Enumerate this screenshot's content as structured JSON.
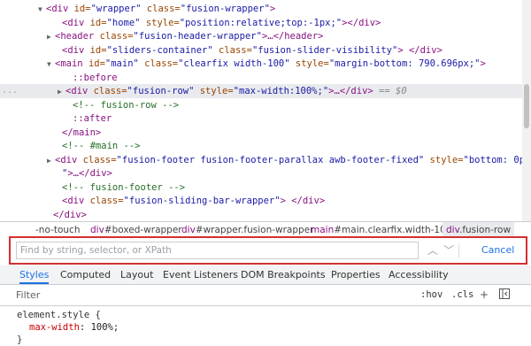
{
  "dom_lines": [
    {
      "tri": "▼",
      "parts": [
        {
          "c": "tag",
          "t": "<div "
        },
        {
          "c": "attr",
          "t": "id="
        },
        {
          "c": "val",
          "t": "\"wrapper\""
        },
        {
          "c": "attr",
          "t": " class="
        },
        {
          "c": "val",
          "t": "\"fusion-wrapper\""
        },
        {
          "c": "tag",
          "t": ">"
        }
      ]
    },
    {
      "tri": "",
      "parts": [
        {
          "c": "tag",
          "t": "<div "
        },
        {
          "c": "attr",
          "t": "id="
        },
        {
          "c": "val",
          "t": "\"home\""
        },
        {
          "c": "attr",
          "t": " style="
        },
        {
          "c": "val",
          "t": "\"position:relative;top:-1px;\""
        },
        {
          "c": "tag",
          "t": "></div>"
        }
      ]
    },
    {
      "tri": "▶",
      "parts": [
        {
          "c": "tag",
          "t": "<header "
        },
        {
          "c": "attr",
          "t": "class="
        },
        {
          "c": "val",
          "t": "\"fusion-header-wrapper\""
        },
        {
          "c": "tag",
          "t": ">…</header>"
        }
      ]
    },
    {
      "tri": "",
      "parts": [
        {
          "c": "tag",
          "t": "<div "
        },
        {
          "c": "attr",
          "t": "id="
        },
        {
          "c": "val",
          "t": "\"sliders-container\""
        },
        {
          "c": "attr",
          "t": " class="
        },
        {
          "c": "val",
          "t": "\"fusion-slider-visibility\""
        },
        {
          "c": "tag",
          "t": "> </div>"
        }
      ]
    },
    {
      "tri": "▼",
      "parts": [
        {
          "c": "tag",
          "t": "<main "
        },
        {
          "c": "attr",
          "t": "id="
        },
        {
          "c": "val",
          "t": "\"main\""
        },
        {
          "c": "attr",
          "t": " class="
        },
        {
          "c": "val",
          "t": "\"clearfix width-100\""
        },
        {
          "c": "attr",
          "t": " style="
        },
        {
          "c": "val",
          "t": "\"margin-bottom: 790.696px;\""
        },
        {
          "c": "tag",
          "t": ">"
        }
      ]
    },
    {
      "tri": "",
      "parts": [
        {
          "c": "pseudo",
          "t": "::before"
        }
      ]
    },
    {
      "tri": "▶",
      "selected": true,
      "parts": [
        {
          "c": "tag",
          "t": "<div "
        },
        {
          "c": "attr",
          "t": "class="
        },
        {
          "c": "val",
          "t": "\"fusion-row\""
        },
        {
          "c": "attr",
          "t": " style="
        },
        {
          "c": "val",
          "t": "\"max-width:100%;\""
        },
        {
          "c": "tag",
          "t": ">…</div>"
        },
        {
          "c": "eq",
          "t": " == $0"
        }
      ]
    },
    {
      "tri": "",
      "parts": [
        {
          "c": "cm",
          "t": "<!-- fusion-row -->"
        }
      ]
    },
    {
      "tri": "",
      "parts": [
        {
          "c": "pseudo",
          "t": "::after"
        }
      ]
    },
    {
      "tri": "",
      "parts": [
        {
          "c": "tag",
          "t": "</main>"
        }
      ]
    },
    {
      "tri": "",
      "parts": [
        {
          "c": "cm",
          "t": "<!-- #main -->"
        }
      ]
    },
    {
      "tri": "▶",
      "parts": [
        {
          "c": "tag",
          "t": "<div "
        },
        {
          "c": "attr",
          "t": "class="
        },
        {
          "c": "val",
          "t": "\"fusion-footer fusion-footer-parallax awb-footer-fixed\""
        },
        {
          "c": "attr",
          "t": " style="
        },
        {
          "c": "val",
          "t": "\"bottom: 0px;"
        }
      ]
    },
    {
      "tri": "",
      "parts": [
        {
          "c": "val",
          "t": "\""
        },
        {
          "c": "tag",
          "t": ">…</div>"
        }
      ]
    },
    {
      "tri": "",
      "parts": [
        {
          "c": "cm",
          "t": "<!-- fusion-footer -->"
        }
      ]
    },
    {
      "tri": "",
      "parts": [
        {
          "c": "tag",
          "t": "<div "
        },
        {
          "c": "attr",
          "t": "class="
        },
        {
          "c": "val",
          "t": "\"fusion-sliding-bar-wrapper\""
        },
        {
          "c": "tag",
          "t": "> </div>"
        }
      ]
    },
    {
      "tri": "",
      "parts": [
        {
          "c": "tag",
          "t": "</div>"
        }
      ]
    }
  ],
  "selected_row_marker": "...",
  "breadcrumbs": [
    {
      "tag": "",
      "rest": "-no-touch"
    },
    {
      "tag": "div",
      "rest": "#boxed-wrapper"
    },
    {
      "tag": "div",
      "rest": "#wrapper.fusion-wrapper"
    },
    {
      "tag": "main",
      "rest": "#main.clearfix.width-100"
    },
    {
      "tag": "div",
      "rest": ".fusion-row",
      "active": true
    }
  ],
  "find": {
    "placeholder": "Find by string, selector, or XPath",
    "value": "",
    "up_icon": "chevron-up",
    "down_icon": "chevron-down",
    "cancel_label": "Cancel"
  },
  "tabs": [
    "Styles",
    "Computed",
    "Layout",
    "Event Listeners",
    "DOM Breakpoints",
    "Properties",
    "Accessibility"
  ],
  "active_tab": "Styles",
  "filter": {
    "placeholder": "Filter",
    "hov_label": ":hov",
    "cls_label": ".cls",
    "add_icon": "+",
    "sidebar_icon": "toggle-sidebar"
  },
  "styles": {
    "selector_line": "element.style {",
    "property": "max-width",
    "value": "100%;",
    "close": "}"
  },
  "colors": {
    "highlight_border": "#d32f2f",
    "accent": "#1a73e8",
    "tag": "#881280",
    "attr": "#994500",
    "value": "#1a1aa6",
    "comment": "#236e25"
  }
}
